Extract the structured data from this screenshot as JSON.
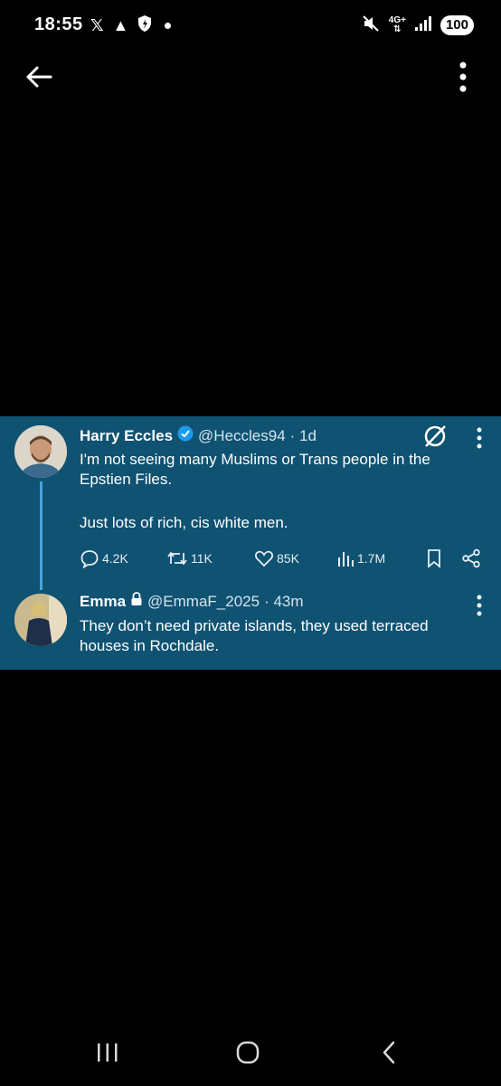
{
  "status_bar": {
    "time": "18:55",
    "network": "4G+",
    "battery": "100"
  },
  "tweet": {
    "author_name": "Harry Eccles",
    "handle": "@Heccles94",
    "time": "· 1d",
    "verified": true,
    "text_line1": "I'm not seeing many Muslims or Trans people in the Epstien Files.",
    "text_line2": "Just lots of rich, cis white men.",
    "stats": {
      "replies": "4.2K",
      "reposts": "11K",
      "likes": "85K",
      "views": "1.7M"
    }
  },
  "reply": {
    "author_name": "Emma",
    "handle": "@EmmaF_2025",
    "time": "· 43m",
    "protected": true,
    "text": "They don’t need private islands, they used terraced houses in Rochdale."
  },
  "colors": {
    "card_background": "#0f5272",
    "thread_line": "#4aa2d8",
    "verified_badge": "#1d9bf0"
  }
}
